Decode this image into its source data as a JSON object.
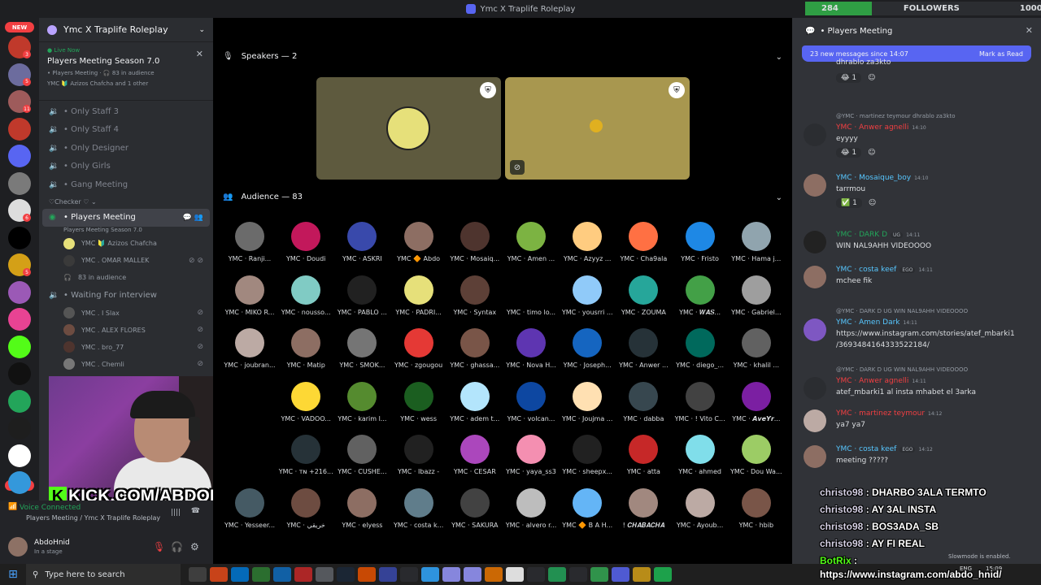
{
  "window": {
    "title": "Ymc X Traplife Roleplay"
  },
  "followers_bar": {
    "current": "284",
    "label": "FOLLOWERS",
    "goal": "1000",
    "progress": 0.284
  },
  "guilds": {
    "new_top": "NEW",
    "new_bottom": "NEW",
    "items": [
      {
        "badge": "3",
        "color": "#c0392b"
      },
      {
        "badge": "5",
        "color": "#6c6c9e"
      },
      {
        "badge": "11",
        "color": "#9e5b5b"
      },
      {
        "badge": "",
        "color": "#c0392b"
      },
      {
        "badge": "",
        "color": "#5865f2"
      },
      {
        "badge": "",
        "color": "#7a7a7a"
      },
      {
        "badge": "6",
        "color": "#dddddd"
      },
      {
        "badge": "",
        "color": "#000000"
      },
      {
        "badge": "5",
        "color": "#d4a017"
      },
      {
        "badge": "",
        "color": "#9b59b6"
      },
      {
        "badge": "",
        "color": "#e84393"
      },
      {
        "badge": "",
        "color": "#53fc18"
      },
      {
        "badge": "",
        "color": "#111111"
      },
      {
        "badge": "",
        "color": "#23a55a"
      },
      {
        "badge": "",
        "color": "#1e1e1e"
      },
      {
        "badge": "",
        "color": "#ffffff"
      },
      {
        "badge": "",
        "color": "#3498db"
      }
    ],
    "kick_label": "KICK"
  },
  "server": {
    "name": "Ymc X Traplife Roleplay"
  },
  "live_card": {
    "status": "Live Now",
    "title": "Players Meeting Season 7.0",
    "channel": "• Players Meeting",
    "audience": "83 in audience",
    "speakers": "YMC 🔰 Azizos Chafcha and 1 other"
  },
  "channels": {
    "voice_rooms": [
      "• Only Staff 3",
      "• Only Staff 4",
      "• Only Designer",
      "• Only Girls",
      "• Gang Meeting"
    ],
    "category": "♡Checker ♡",
    "stage": {
      "name": "• Players Meeting",
      "topic": "Players Meeting Season 7.0"
    },
    "stage_members": [
      "YMC 🔰 Azizos Chafcha",
      "YMC . OMAR MALLEK"
    ],
    "stage_audience": "83 in audience",
    "waiting_room": "• Waiting For interview",
    "waiting_members": [
      "YMC . I Slax",
      "YMC . ALEX FLORES",
      "YMC . bro_77",
      "YMC . Chemli"
    ]
  },
  "stream_overlay": {
    "kick_url": "KICK.COM/ABDOHNID"
  },
  "voice_status": {
    "label": "Voice Connected",
    "location": "Players Meeting / Ymc X Traplife Roleplay"
  },
  "user": {
    "name": "AbdoHnid",
    "status": "In a stage"
  },
  "stage_main": {
    "speakers_label": "Speakers — 2",
    "audience_label": "Audience — 83",
    "audience": [
      "YMC · Ranji...",
      "YMC · Doudi",
      "YMC · ASKRI",
      "YMC 🔶 Abdo",
      "YMC · Mosaiq...",
      "YMC · Amen ...",
      "YMC · Azyyz ...",
      "YMC · Cha9ala",
      "YMC · Fristo",
      "YMC · Hama j...",
      "YMC · MIKO R...",
      "YMC · nousso...",
      "YMC · PABLO ...",
      "YMC · PADRI...",
      "YMC · Syntax",
      "YMC · timo lo...",
      "YMC · yousrri ...",
      "YMC · ZOUMA",
      "YMC · 𝑾𝑨𝑺...",
      "YMC · Gabriel...",
      "YMC · joubran...",
      "YMC · Matip",
      "YMC · SMOK...",
      "YMC · zgougou",
      "YMC · ghassa...",
      "YMC · Nova H...",
      "YMC · Joseph...",
      "YMC · Anwer ...",
      "YMC · diego_...",
      "YMC · khalil ...",
      "YMC · VADOO...",
      "YMC · karim l...",
      "YMC · wess",
      "YMC · adem t...",
      "YMC · volcan...",
      "YMC · Joujma ...",
      "YMC · dabba",
      "YMC · ! Vito C...",
      "YMC · 𝘼𝙫𝙚𝙔𝙧...",
      "YMC · ᴛɴ +216...",
      "YMC · CUSHE...",
      "YMC · Ibazz -",
      "YMC · CESAR",
      "YMC · yaya_ss3",
      "YMC · sheepx...",
      "YMC · atta",
      "YMC · ahmed",
      "YMC · Dou Wa...",
      "YMC · Yesseer...",
      "YMC · خريقي",
      "YMC · elyess",
      "YMC · costa k...",
      "YMC · SAKURA",
      "YMC · alvero r...",
      "YMC 🔶 B A H...",
      "! 𝑪𝑯𝑨𝑩𝑨𝑪𝑯𝑨",
      "YMC · Ayoub...",
      "YMC · hbib"
    ],
    "audience_colors": [
      "#6b6b6b",
      "#c2185b",
      "#3949ab",
      "#8d6e63",
      "#4e342e",
      "#7cb342",
      "#ffcc80",
      "#ff7043",
      "#1e88e5",
      "#90a4ae",
      "#a1887f",
      "#80cbc4",
      "#212121",
      "#e6e07a",
      "#5d4037",
      "#000000",
      "#90caf9",
      "#26a69a",
      "#43a047",
      "#9e9e9e",
      "#bcaaa4",
      "#8d6e63",
      "#757575",
      "#e53935",
      "#795548",
      "#5e35b1",
      "#1565c0",
      "#263238",
      "#00695c",
      "#616161",
      "#fdd835",
      "#558b2f",
      "#1b5e20",
      "#b3e5fc",
      "#0d47a1",
      "#ffe0b2",
      "#37474f",
      "#424242",
      "#7b1fa2",
      "#263238",
      "#616161",
      "#212121",
      "#ab47bc",
      "#f48fb1",
      "#212121",
      "#c62828",
      "#80deea",
      "#9ccc65",
      "#455a64",
      "#6d4c41",
      "#8d6e63",
      "#607d8b",
      "#424242",
      "#bdbdbd",
      "#64b5f6",
      "#a1887f",
      "#bcaaa4",
      "#795548"
    ]
  },
  "chat": {
    "channel": "• Players Meeting",
    "new_banner": "23 new messages since 14:07",
    "mark_read": "Mark as Read",
    "msgs": [
      {
        "body": "dhrablo za3kto",
        "react": "1"
      },
      {
        "reply": "@YMC · martinez teymour dhrablo za3kto",
        "author": "YMC · Anwer agnelli",
        "time": "14:10",
        "body": "eyyyy",
        "react": "1"
      },
      {
        "author": "YMC · Mosaique_boy",
        "time": "14:10",
        "body": "tarrmou",
        "react": "1"
      },
      {
        "author": "YMC · DARK D",
        "tag": "UG",
        "time": "14:11",
        "body": "WIN NAL9AHH VIDEOOOO"
      },
      {
        "author": "YMC · costa keef",
        "tag": "EGO",
        "time": "14:11",
        "body": "mchee fik"
      },
      {
        "reply": "@YMC · DARK D UG WIN NAL9AHH VIDEOOOO",
        "author": "YMC · Amen Dark",
        "time": "14:11",
        "body": "https://www.instagram.com/stories/atef_mbarki1",
        "body2": "/3693484164333522184/"
      },
      {
        "reply": "@YMC · DARK D UG WIN NAL9AHH VIDEOOOO",
        "author": "YMC · Anwer agnelli",
        "time": "14:11",
        "body": "atef_mbarki1 al insta mhabet el 3arka"
      },
      {
        "author": "YMC · martinez teymour",
        "time": "14:12",
        "body": "ya7 ya7"
      },
      {
        "author": "YMC · costa keef",
        "tag": "EGO",
        "time": "14:12",
        "body": "meeting ?????"
      }
    ],
    "slowmode": "Slowmode is enabled."
  },
  "kick_chat": [
    {
      "user": "christo98",
      "text": "DHARBO 3ALA TERMTO"
    },
    {
      "user": "christo98",
      "text": "AY 3AL INSTA"
    },
    {
      "user": "christo98",
      "text": "BOS3ADA_SB"
    },
    {
      "user": "christo98",
      "text": "AY FI REAL"
    },
    {
      "user": "BotRix",
      "text": ""
    }
  ],
  "kick_link": "https://www.instagram.com/abdo_hnid/",
  "taskbar": {
    "search_placeholder": "Type here to search",
    "lang": "ENG",
    "time": "15:09"
  }
}
